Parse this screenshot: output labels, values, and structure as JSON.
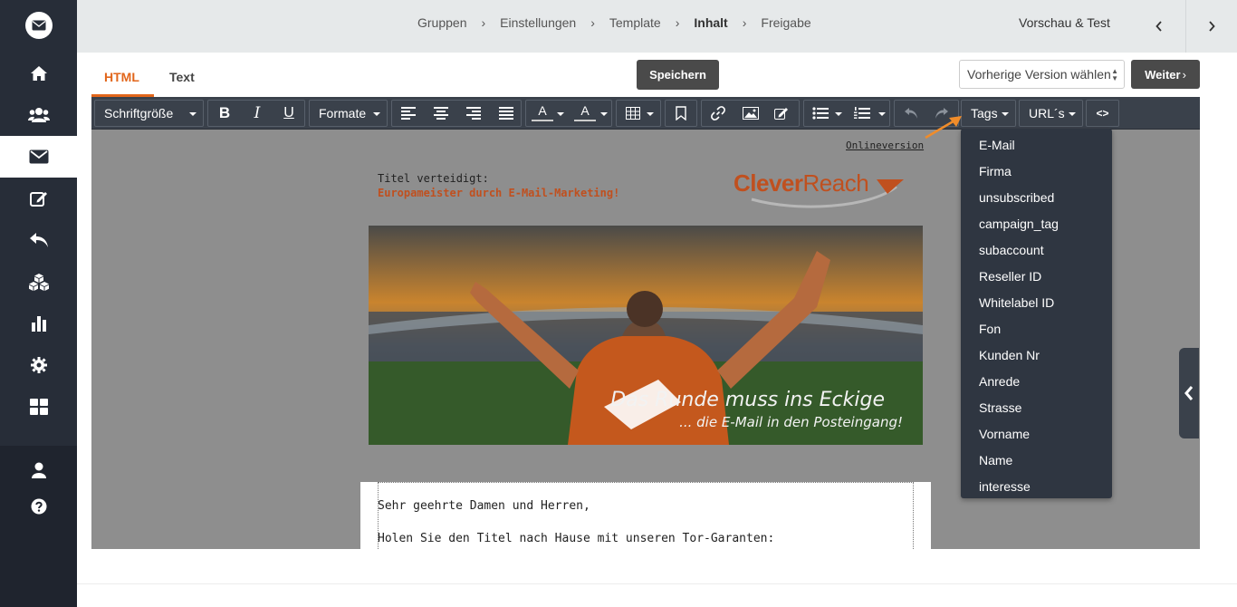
{
  "breadcrumb": {
    "items": [
      "Gruppen",
      "Einstellungen",
      "Template",
      "Inhalt",
      "Freigabe"
    ],
    "separator": "›",
    "active_index": 3
  },
  "header": {
    "preview_label": "Vorschau & Test"
  },
  "tabs": [
    {
      "label": "HTML",
      "active": true
    },
    {
      "label": "Text",
      "active": false
    }
  ],
  "actions": {
    "save_label": "Speichern",
    "version_select_value": "Vorherige Version wählen",
    "next_label": "Weiter",
    "next_glyph": "›"
  },
  "toolbar": {
    "font_size_label": "Schriftgröße",
    "formats_label": "Formate",
    "text_color_glyph": "A",
    "bg_color_glyph": "A",
    "tags_label": "Tags",
    "urls_label": "URL´s",
    "bold_glyph": "B",
    "italic_glyph": "I",
    "underline_glyph": "U",
    "source_glyph": "<>"
  },
  "tags_menu": {
    "items": [
      "E-Mail",
      "Firma",
      "unsubscribed",
      "campaign_tag",
      "subaccount",
      "Reseller ID",
      "Whitelabel ID",
      "Fon",
      "Kunden Nr",
      "Anrede",
      "Strasse",
      "Vorname",
      "Name",
      "interesse"
    ]
  },
  "email": {
    "online_version": "Onlineversion",
    "title_line1": "Titel verteidigt:",
    "title_line2": "Europameister durch E-Mail-Marketing!",
    "logo_clever": "Clever",
    "logo_reach": "Reach",
    "hero_slogan": "Das Runde muss ins Eckige",
    "hero_sub": "... die E-Mail in den Posteingang!",
    "greeting": "Sehr geehrte Damen und Herren,",
    "intro": "Holen Sie den Titel nach Hause mit unseren Tor-Garanten:"
  },
  "colors": {
    "accent": "#e2661b",
    "sidebar": "#272d38",
    "toolbar": "#3a414b",
    "brand_orange": "#c0501f"
  },
  "sidebar_icons": [
    "envelope-logo-icon",
    "home-icon",
    "users-icon",
    "mail-icon",
    "edit-icon",
    "reply-icon",
    "cubes-icon",
    "chart-icon",
    "gear-icon",
    "dashboard-icon",
    "user-icon",
    "help-icon"
  ]
}
